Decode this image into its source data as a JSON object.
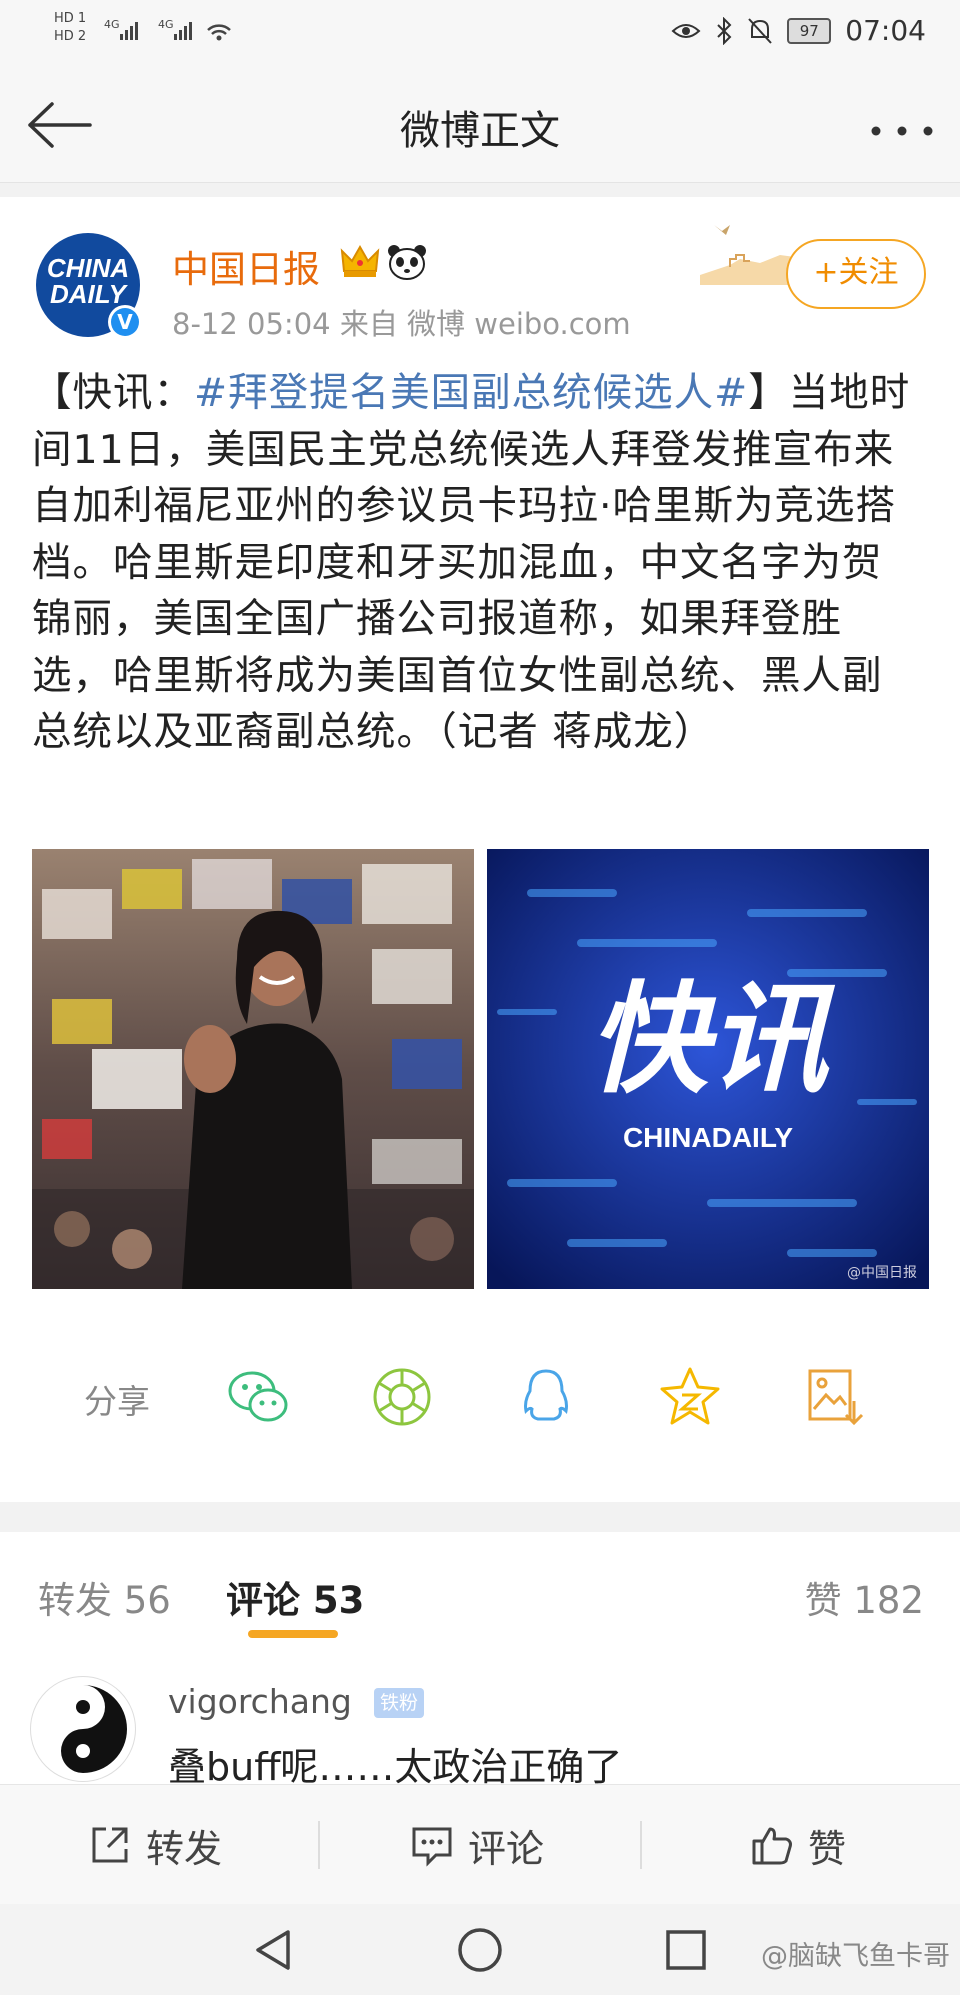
{
  "status_bar": {
    "hd1": "HD 1",
    "hd2": "HD 2",
    "net1": "4G",
    "net2": "4G",
    "battery": "97",
    "time": "07:04"
  },
  "nav": {
    "title": "微博正文"
  },
  "post": {
    "author": "中国日报",
    "avatar_text_line1": "CHINA",
    "avatar_text_line2": "DAILY",
    "meta": "8-12 05:04   来自 微博 weibo.com",
    "follow_label": "+关注",
    "body_prefix": "【快讯：",
    "body_topic": "#拜登提名美国副总统候选人#",
    "body_rest": "】当地时间11日，美国民主党总统候选人拜登发推宣布来自加利福尼亚州的参议员卡玛拉·哈里斯为竞选搭档。哈里斯是印度和牙买加混血，中文名字为贺锦丽，美国全国广播公司报道称，如果拜登胜选，哈里斯将成为美国首位女性副总统、黑人副总统以及亚裔副总统。（记者 蒋成龙）",
    "image2_main": "快讯",
    "image2_sub": "CHINADAILY",
    "image2_credit": "@中国日报"
  },
  "share": {
    "label": "分享",
    "icons": [
      "wechat-icon",
      "moments-icon",
      "qq-icon",
      "qzone-icon",
      "save-image-icon"
    ]
  },
  "tabs": {
    "repost": "转发 56",
    "comments": "评论 53",
    "likes": "赞 182"
  },
  "comment": {
    "user": "vigorchang",
    "badge": "铁粉",
    "text": "叠buff呢……太政治正确了"
  },
  "toolbar": {
    "repost": "转发",
    "comment": "评论",
    "like": "赞"
  },
  "watermark": "@脑缺飞鱼卡哥",
  "colors": {
    "accent_orange": "#f5a623",
    "author_orange": "#e86b0c",
    "topic_blue": "#4a78b5"
  }
}
